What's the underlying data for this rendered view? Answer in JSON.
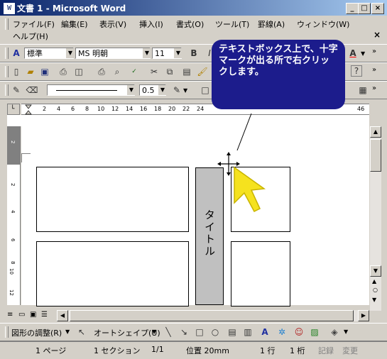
{
  "window": {
    "title": "文書 1 - Microsoft Word",
    "app_icon": "W",
    "min": "_",
    "max": "□",
    "close": "×"
  },
  "menu": {
    "items": [
      "ファイル(F)",
      "編集(E)",
      "表示(V)",
      "挿入(I)",
      "書式(O)",
      "ツール(T)",
      "罫線(A)",
      "ウィンドウ(W)"
    ],
    "help": "ヘルプ(H)"
  },
  "format_toolbar": {
    "style": "標準",
    "font": "MS 明朝",
    "size": "11"
  },
  "drawing_toolbar": {
    "line_width": "0.5",
    "adjust": "図形の調整(R)",
    "autoshape": "オートシェイプ(U)"
  },
  "ruler_ticks": [
    "2",
    "4",
    "6",
    "8",
    "10",
    "12",
    "14",
    "16",
    "18",
    "20",
    "22",
    "24",
    "46"
  ],
  "vruler_ticks": [
    "2",
    "2",
    "4",
    "6",
    "8",
    "10",
    "12"
  ],
  "callout": {
    "text": "テキストボックス上で、十字マークが出る所で右クリックします。"
  },
  "document": {
    "title_box_text": "タイトル"
  },
  "status": {
    "page": "1 ページ",
    "section": "1 セクション",
    "pages": "1/1",
    "position": "位置 20mm",
    "line": "1 行",
    "column": "1 桁",
    "rec": "記録",
    "trk": "変更"
  }
}
